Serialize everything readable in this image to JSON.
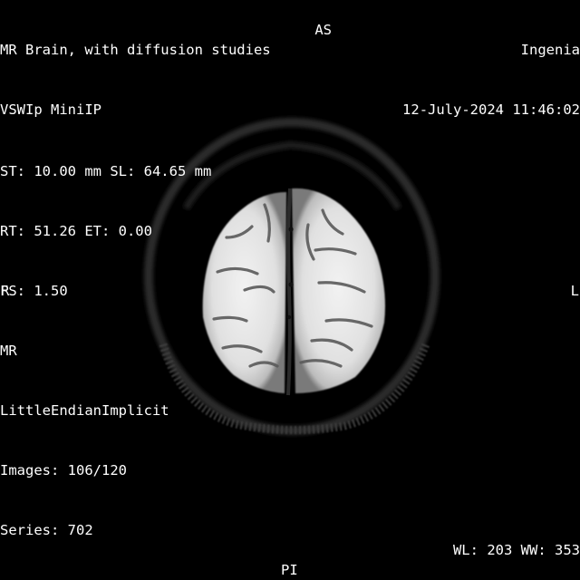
{
  "overlay": {
    "top_left": [
      "MR Brain, with diffusion studies",
      "VSWIp MiniIP"
    ],
    "top_right": [
      "Ingenia",
      "12-July-2024 11:46:02"
    ],
    "orientation": {
      "top": "A",
      "bottom": "PI",
      "left": "R",
      "right": "L",
      "top_suffix": "S"
    },
    "bottom_left": [
      "ST: 10.00 mm SL: 64.65 mm",
      "RT: 51.26 ET: 0.00",
      "FS: 1.50",
      "MR",
      "LittleEndianImplicit",
      "Images: 106/120",
      "Series: 702"
    ],
    "window": {
      "wl_label": "WL:",
      "wl": "203",
      "ww_label": "WW:",
      "ww": "353"
    }
  },
  "image": {
    "modality": "MR",
    "view": "axial brain slice",
    "background_color": "#000000",
    "tissue_color": "#e6e6e6"
  }
}
